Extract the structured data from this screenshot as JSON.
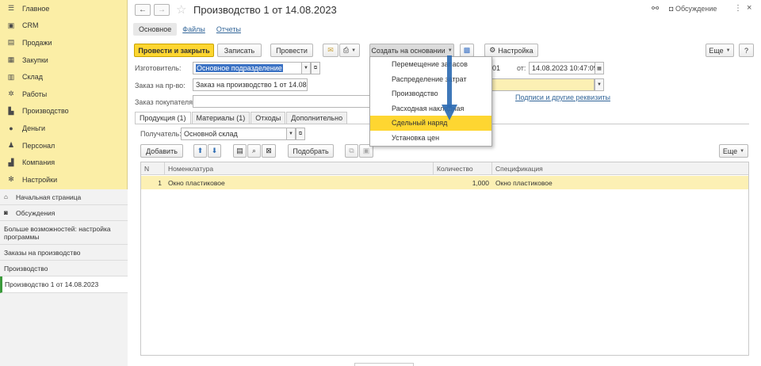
{
  "sidebar": {
    "sections": [
      {
        "label": "Главное",
        "icon": "menu-icon"
      },
      {
        "label": "CRM",
        "icon": "crm-icon"
      },
      {
        "label": "Продажи",
        "icon": "cart-icon"
      },
      {
        "label": "Закупки",
        "icon": "truck-icon"
      },
      {
        "label": "Склад",
        "icon": "warehouse-icon"
      },
      {
        "label": "Работы",
        "icon": "gear-icon"
      },
      {
        "label": "Производство",
        "icon": "factory-icon"
      },
      {
        "label": "Деньги",
        "icon": "coin-icon"
      },
      {
        "label": "Персонал",
        "icon": "person-icon"
      },
      {
        "label": "Компания",
        "icon": "building-icon"
      },
      {
        "label": "Настройки",
        "icon": "settings-icon"
      }
    ],
    "open_windows": [
      {
        "label": "Начальная страница",
        "icon": "home-icon"
      },
      {
        "label": "Обсуждения",
        "icon": "chat-icon"
      },
      {
        "label": "Больше возможностей: настройка программы"
      },
      {
        "label": "Заказы на производство"
      },
      {
        "label": "Производство"
      },
      {
        "label": "Производство 1 от 14.08.2023",
        "active": true
      }
    ]
  },
  "header": {
    "title": "Производство 1 от 14.08.2023",
    "discussion_label": "Обсуждение"
  },
  "form_tabs": [
    "Основное",
    "Файлы",
    "Отчеты"
  ],
  "toolbar": {
    "post_and_close": "Провести и закрыть",
    "save": "Записать",
    "post": "Провести",
    "create_based_on": "Создать на основании",
    "settings": "Настройка",
    "more": "Еще",
    "help": "?"
  },
  "fields": {
    "manufacturer_label": "Изготовитель:",
    "manufacturer_value": "Основное подразделение",
    "number_suffix": "01",
    "date_label": "от:",
    "date_value": "14.08.2023 10:47:09",
    "order_label": "Заказ на пр-во:",
    "order_value": "Заказ на производство 1 от 14.08.2023",
    "customer_order_label": "Заказ покупателя:",
    "signatures_link": "Подписи и другие реквизиты"
  },
  "product_tabs": [
    "Продукция (1)",
    "Материалы (1)",
    "Отходы",
    "Дополнительно"
  ],
  "recipient": {
    "label": "Получатель:",
    "value": "Основной склад"
  },
  "table_toolbar": {
    "add": "Добавить",
    "pick": "Подобрать",
    "more": "Еще"
  },
  "table": {
    "columns": [
      "N",
      "Номенклатура",
      "Количество",
      "Спецификация"
    ],
    "rows": [
      {
        "n": "1",
        "item": "Окно пластиковое",
        "qty": "1,000",
        "spec": "Окно пластиковое"
      }
    ]
  },
  "dropdown": {
    "items": [
      {
        "label": "Перемещение запасов"
      },
      {
        "label": "Распределение затрат"
      },
      {
        "label": "Производство"
      },
      {
        "label": "Расходная накладная"
      },
      {
        "label": "Сдельный наряд",
        "highlighted": true
      },
      {
        "label": "Установка цен"
      }
    ]
  },
  "colors": {
    "accent": "#fed631",
    "sidebar": "#fbeea6",
    "selection": "#3b72c4",
    "arrow": "#2f6db3"
  }
}
